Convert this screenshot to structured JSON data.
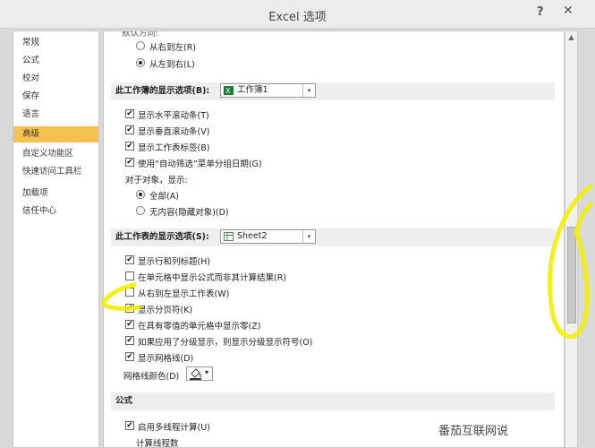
{
  "window": {
    "title": "Excel 选项",
    "help": "?",
    "close": "✕"
  },
  "sidebar": {
    "items": [
      {
        "label": "常规"
      },
      {
        "label": "公式"
      },
      {
        "label": "校对"
      },
      {
        "label": "保存"
      },
      {
        "label": "语言"
      },
      {
        "label": "高级",
        "active": true
      },
      {
        "label": "自定义功能区"
      },
      {
        "label": "快速访问工具栏"
      },
      {
        "label": "加载项"
      },
      {
        "label": "信任中心"
      }
    ]
  },
  "direction": {
    "heading": "默认方向:",
    "rtl": {
      "label": "从右到左(R)",
      "selected": false
    },
    "ltr": {
      "label": "从左到右(L)",
      "selected": true
    }
  },
  "workbook_section": {
    "label": "此工作簿的显示选项(B):",
    "combo_value": "工作簿1",
    "options": [
      {
        "label": "显示水平滚动条(T)",
        "checked": true
      },
      {
        "label": "显示垂直滚动条(V)",
        "checked": true
      },
      {
        "label": "显示工作表标签(B)",
        "checked": true
      },
      {
        "label": "使用“自动筛选”菜单分组日期(G)",
        "checked": true
      }
    ],
    "objects_label": "对于对象，显示:",
    "all": {
      "label": "全部(A)",
      "selected": true
    },
    "none": {
      "label": "无内容(隐藏对象)(D)",
      "selected": false
    }
  },
  "sheet_section": {
    "label": "此工作表的显示选项(S):",
    "combo_value": "Sheet2",
    "options": [
      {
        "label": "显示行和列标题(H)",
        "checked": true
      },
      {
        "label": "在单元格中显示公式而非其计算结果(R)",
        "checked": false
      },
      {
        "label": "从右到左显示工作表(W)",
        "checked": false
      },
      {
        "label": "显示分页符(K)",
        "checked": true
      },
      {
        "label": "在具有零值的单元格中显示零(Z)",
        "checked": true
      },
      {
        "label": "如果应用了分级显示，则显示分级显示符号(O)",
        "checked": true
      },
      {
        "label": "显示网格线(D)",
        "checked": true
      }
    ],
    "gridline_color_label": "网格线颜色(D)",
    "gridline_color_arrow": "▾"
  },
  "formulas_section": {
    "label": "公式",
    "multithread": {
      "label": "启用多线程计算(U)",
      "checked": true
    },
    "thread_count_label": "计算线程数"
  },
  "watermark": {
    "text": "番茄互联网说"
  },
  "icons": {
    "check": "✔",
    "dropdown": "▾",
    "scroll_up": "▲"
  },
  "colors": {
    "active_item": "#f6c24f",
    "annotation": "#f2ef00",
    "excel_green": "#1e7b3c"
  }
}
